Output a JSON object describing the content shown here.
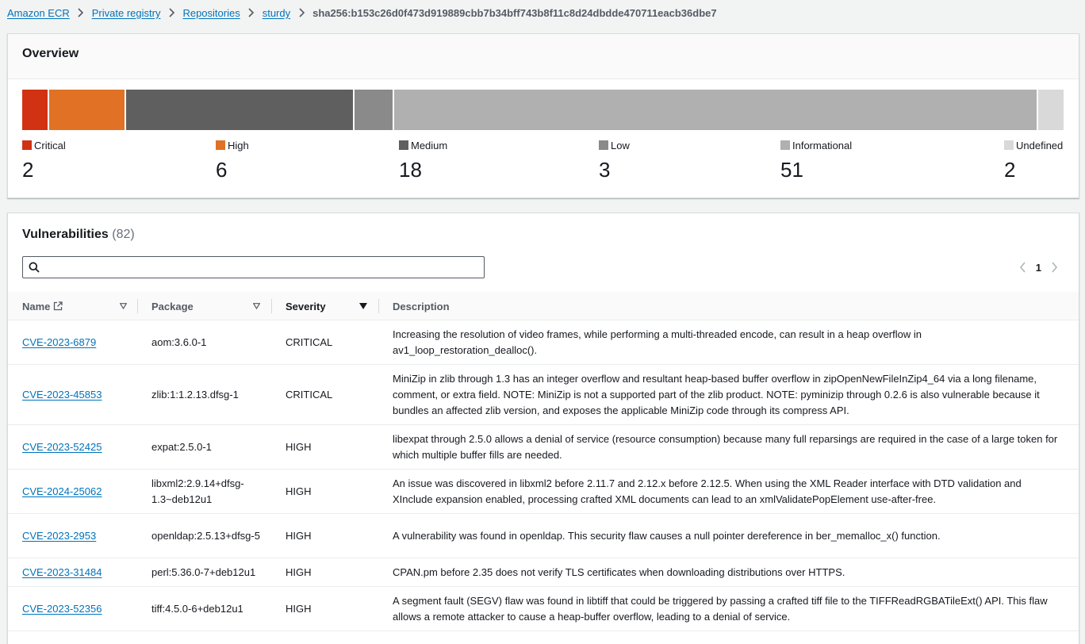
{
  "breadcrumb": {
    "items": [
      "Amazon ECR",
      "Private registry",
      "Repositories",
      "sturdy"
    ],
    "current": "sha256:b153c26d0f473d919889cbb7b34bff743b8f11c8d24dbdde470711eacb36dbe7"
  },
  "overview": {
    "title": "Overview",
    "severities": [
      {
        "label": "Critical",
        "count": "2",
        "color": "#d13212"
      },
      {
        "label": "High",
        "count": "6",
        "color": "#e07125"
      },
      {
        "label": "Medium",
        "count": "18",
        "color": "#5f5f5f"
      },
      {
        "label": "Low",
        "count": "3",
        "color": "#8a8a8a"
      },
      {
        "label": "Informational",
        "count": "51",
        "color": "#b0b0b0"
      },
      {
        "label": "Undefined",
        "count": "2",
        "color": "#d9d9d9"
      }
    ]
  },
  "vulnerabilities": {
    "title": "Vulnerabilities",
    "count": "(82)",
    "search_placeholder": "",
    "page": "1",
    "columns": {
      "name": "Name",
      "package": "Package",
      "severity": "Severity",
      "description": "Description"
    },
    "rows": [
      {
        "name": "CVE-2023-6879",
        "package": "aom:3.6.0-1",
        "severity": "CRITICAL",
        "description": "Increasing the resolution of video frames, while performing a multi-threaded encode, can result in a heap overflow in av1_loop_restoration_dealloc()."
      },
      {
        "name": "CVE-2023-45853",
        "package": "zlib:1:1.2.13.dfsg-1",
        "severity": "CRITICAL",
        "description": "MiniZip in zlib through 1.3 has an integer overflow and resultant heap-based buffer overflow in zipOpenNewFileInZip4_64 via a long filename, comment, or extra field. NOTE: MiniZip is not a supported part of the zlib product. NOTE: pyminizip through 0.2.6 is also vulnerable because it bundles an affected zlib version, and exposes the applicable MiniZip code through its compress API."
      },
      {
        "name": "CVE-2023-52425",
        "package": "expat:2.5.0-1",
        "severity": "HIGH",
        "description": "libexpat through 2.5.0 allows a denial of service (resource consumption) because many full reparsings are required in the case of a large token for which multiple buffer fills are needed."
      },
      {
        "name": "CVE-2024-25062",
        "package": "libxml2:2.9.14+dfsg-1.3~deb12u1",
        "severity": "HIGH",
        "description": "An issue was discovered in libxml2 before 2.11.7 and 2.12.x before 2.12.5. When using the XML Reader interface with DTD validation and XInclude expansion enabled, processing crafted XML documents can lead to an xmlValidatePopElement use-after-free."
      },
      {
        "name": "CVE-2023-2953",
        "package": "openldap:2.5.13+dfsg-5",
        "severity": "HIGH",
        "description": "A vulnerability was found in openldap. This security flaw causes a null pointer dereference in ber_memalloc_x() function."
      },
      {
        "name": "CVE-2023-31484",
        "package": "perl:5.36.0-7+deb12u1",
        "severity": "HIGH",
        "description": "CPAN.pm before 2.35 does not verify TLS certificates when downloading distributions over HTTPS."
      },
      {
        "name": "CVE-2023-52356",
        "package": "tiff:4.5.0-6+deb12u1",
        "severity": "HIGH",
        "description": "A segment fault (SEGV) flaw was found in libtiff that could be triggered by passing a crafted tiff file to the TIFFReadRGBATileExt() API. This flaw allows a remote attacker to cause a heap-buffer overflow, leading to a denial of service."
      }
    ]
  }
}
